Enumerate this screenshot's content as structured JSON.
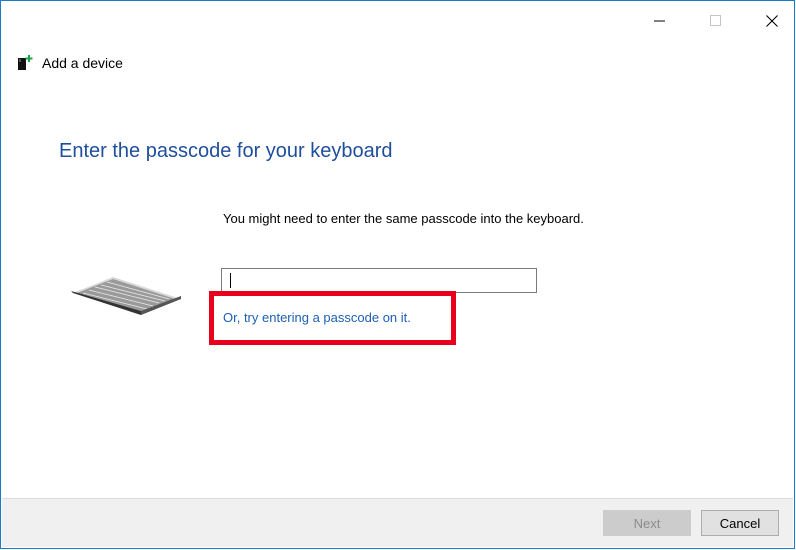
{
  "window": {
    "controls": [
      "minimize-icon",
      "maximize-icon",
      "close-icon"
    ]
  },
  "header": {
    "title": "Add a device",
    "icon": "add-device-icon"
  },
  "main": {
    "heading": "Enter the passcode for your keyboard",
    "instruction": "You might need to enter the same passcode into the keyboard.",
    "passcode": {
      "value": "",
      "placeholder": ""
    },
    "alt_link": "Or, try entering a passcode on it.",
    "device_image": "keyboard-image"
  },
  "footer": {
    "next_label": "Next",
    "cancel_label": "Cancel"
  },
  "colors": {
    "heading": "#1f4e9c",
    "link": "#1d5fb4",
    "highlight": "#e8001c",
    "window_border": "#1979ca"
  }
}
